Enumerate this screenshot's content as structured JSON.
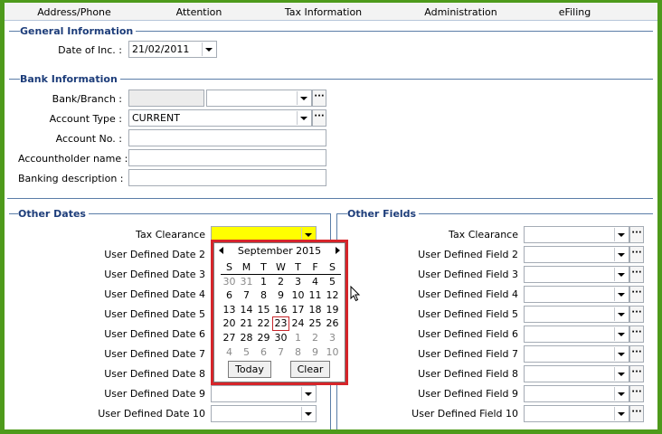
{
  "tabs": [
    "Address/Phone",
    "Attention",
    "Tax Information",
    "Administration",
    "eFiling"
  ],
  "general": {
    "title": "General Information",
    "date_of_inc_label": "Date of Inc. :",
    "date_of_inc_value": "21/02/2011"
  },
  "bank": {
    "title": "Bank Information",
    "branch_label": "Bank/Branch :",
    "account_type_label": "Account Type :",
    "account_type_value": "CURRENT",
    "account_no_label": "Account No. :",
    "holder_label": "Accountholder name :",
    "banking_desc_label": "Banking description :"
  },
  "other_dates": {
    "title": "Other Dates",
    "labels": [
      "Tax Clearance",
      "User Defined Date 2",
      "User Defined Date 3",
      "User Defined Date 4",
      "User Defined Date 5",
      "User Defined Date 6",
      "User Defined Date 7",
      "User Defined Date 8",
      "User Defined Date 9",
      "User Defined Date 10"
    ]
  },
  "other_fields": {
    "title": "Other Fields",
    "labels": [
      "Tax Clearance",
      "User Defined Field 2",
      "User Defined Field 3",
      "User Defined Field 4",
      "User Defined Field 5",
      "User Defined Field 6",
      "User Defined Field 7",
      "User Defined Field 8",
      "User Defined Field 9",
      "User Defined Field 10"
    ]
  },
  "calendar": {
    "month_label": "September 2015",
    "dow": [
      "S",
      "M",
      "T",
      "W",
      "T",
      "F",
      "S"
    ],
    "weeks": [
      [
        "30",
        "31",
        "1",
        "2",
        "3",
        "4",
        "5"
      ],
      [
        "6",
        "7",
        "8",
        "9",
        "10",
        "11",
        "12"
      ],
      [
        "13",
        "14",
        "15",
        "16",
        "17",
        "18",
        "19"
      ],
      [
        "20",
        "21",
        "22",
        "23",
        "24",
        "25",
        "26"
      ],
      [
        "27",
        "28",
        "29",
        "30",
        "1",
        "2",
        "3"
      ],
      [
        "4",
        "5",
        "6",
        "7",
        "8",
        "9",
        "10"
      ]
    ],
    "today_button": "Today",
    "clear_button": "Clear"
  }
}
